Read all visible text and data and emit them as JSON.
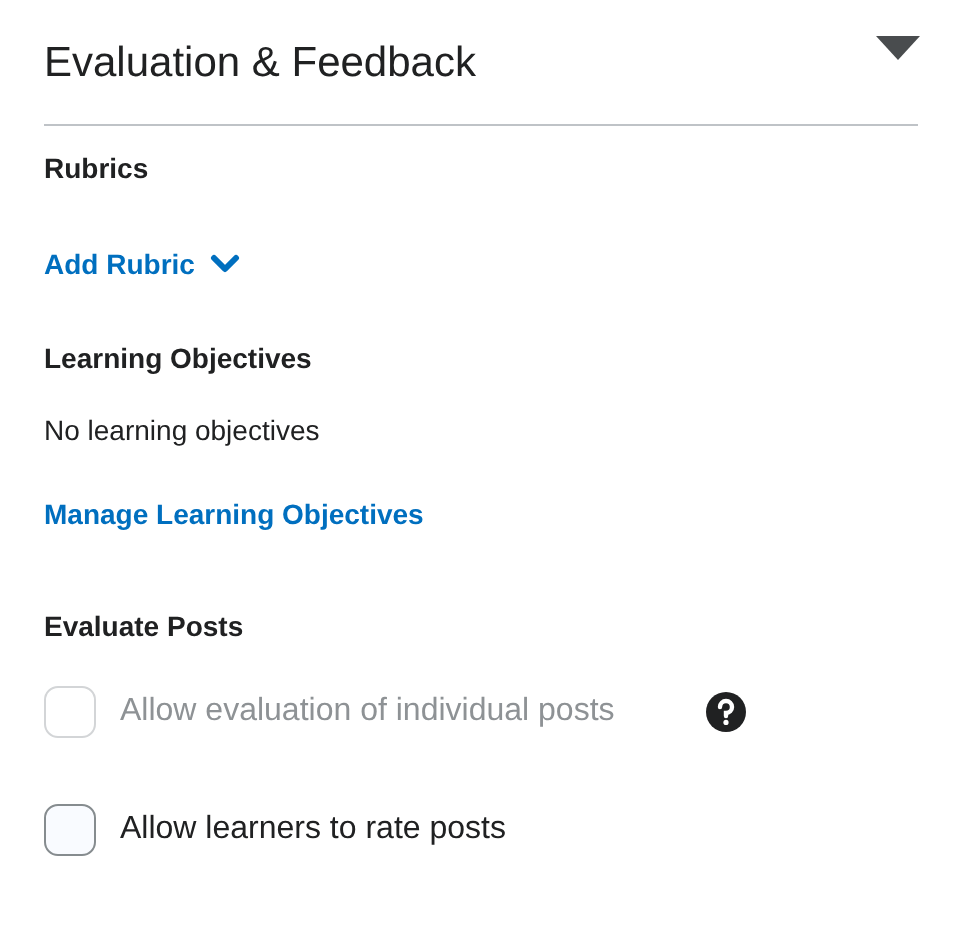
{
  "section": {
    "title": "Evaluation & Feedback",
    "expanded": true
  },
  "rubrics": {
    "heading": "Rubrics",
    "add_button": "Add Rubric"
  },
  "learning_objectives": {
    "heading": "Learning Objectives",
    "empty_text": "No learning objectives",
    "manage_link": "Manage Learning Objectives"
  },
  "evaluate_posts": {
    "heading": "Evaluate Posts",
    "options": [
      {
        "label": "Allow evaluation of individual posts",
        "checked": false,
        "disabled": true,
        "help": true
      },
      {
        "label": "Allow learners to rate posts",
        "checked": false,
        "disabled": false,
        "help": false
      }
    ]
  }
}
